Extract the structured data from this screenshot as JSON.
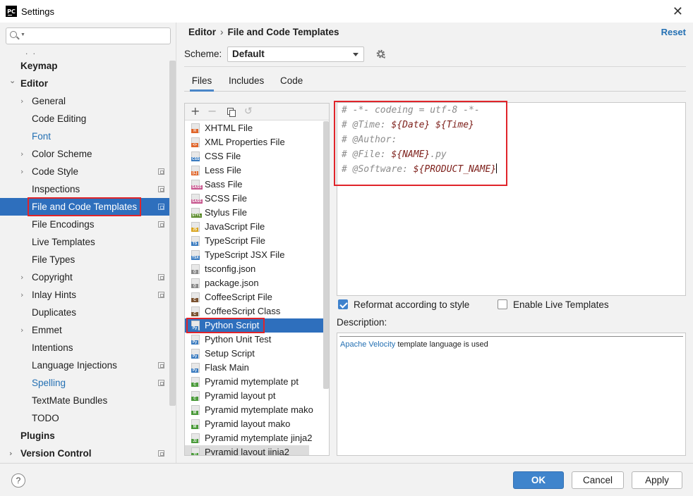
{
  "window": {
    "title": "Settings",
    "app_logo": "PC"
  },
  "sidebar": {
    "search": {
      "value": "",
      "placeholder": ""
    },
    "ellipsis": ". .",
    "items": [
      {
        "label": "Keymap",
        "level": 0,
        "bold": true
      },
      {
        "label": "Editor",
        "level": 0,
        "bold": true,
        "expanded": true
      },
      {
        "label": "General",
        "level": 1,
        "arrow": true
      },
      {
        "label": "Code Editing",
        "level": 1
      },
      {
        "label": "Font",
        "level": 1,
        "blue": true
      },
      {
        "label": "Color Scheme",
        "level": 1,
        "arrow": true
      },
      {
        "label": "Code Style",
        "level": 1,
        "arrow": true,
        "copy": true
      },
      {
        "label": "Inspections",
        "level": 1,
        "copy": true
      },
      {
        "label": "File and Code Templates",
        "level": 1,
        "copy": true,
        "selected": true
      },
      {
        "label": "File Encodings",
        "level": 1,
        "copy": true
      },
      {
        "label": "Live Templates",
        "level": 1
      },
      {
        "label": "File Types",
        "level": 1
      },
      {
        "label": "Copyright",
        "level": 1,
        "arrow": true,
        "copy": true
      },
      {
        "label": "Inlay Hints",
        "level": 1,
        "arrow": true,
        "copy": true
      },
      {
        "label": "Duplicates",
        "level": 1
      },
      {
        "label": "Emmet",
        "level": 1,
        "arrow": true
      },
      {
        "label": "Intentions",
        "level": 1
      },
      {
        "label": "Language Injections",
        "level": 1,
        "copy": true
      },
      {
        "label": "Spelling",
        "level": 1,
        "blue": true,
        "copy": true
      },
      {
        "label": "TextMate Bundles",
        "level": 1
      },
      {
        "label": "TODO",
        "level": 1
      },
      {
        "label": "Plugins",
        "level": 0,
        "bold": true
      },
      {
        "label": "Version Control",
        "level": 0,
        "bold": true,
        "arrow": true,
        "copy": true
      }
    ]
  },
  "header": {
    "breadcrumb": [
      "Editor",
      "File and Code Templates"
    ],
    "reset_label": "Reset",
    "scheme_label": "Scheme:",
    "scheme_value": "Default"
  },
  "tabs": [
    "Files",
    "Includes",
    "Code"
  ],
  "active_tab": "Files",
  "templates": [
    {
      "label": "XHTML File",
      "badge": "H",
      "color": "#e0662b"
    },
    {
      "label": "XML Properties File",
      "badge": "<>",
      "color": "#e0662b"
    },
    {
      "label": "CSS File",
      "badge": "CSS",
      "color": "#3a7bbf"
    },
    {
      "label": "Less File",
      "badge": "{L}",
      "color": "#e0662b"
    },
    {
      "label": "Sass File",
      "badge": "SASS",
      "color": "#c6538c"
    },
    {
      "label": "SCSS File",
      "badge": "SASS",
      "color": "#c6538c"
    },
    {
      "label": "Stylus File",
      "badge": "STYL",
      "color": "#5a8a2a"
    },
    {
      "label": "JavaScript File",
      "badge": "JS",
      "color": "#d9a520"
    },
    {
      "label": "TypeScript File",
      "badge": "TS",
      "color": "#3a7bbf"
    },
    {
      "label": "TypeScript JSX File",
      "badge": "TSX",
      "color": "#3a7bbf"
    },
    {
      "label": "tsconfig.json",
      "badge": "{}",
      "color": "#888888"
    },
    {
      "label": "package.json",
      "badge": "{}",
      "color": "#888888"
    },
    {
      "label": "CoffeeScript File",
      "badge": "C",
      "color": "#7a5230"
    },
    {
      "label": "CoffeeScript Class",
      "badge": "C",
      "color": "#7a5230"
    },
    {
      "label": "Python Script",
      "badge": "Py",
      "color": "#3a7bbf",
      "selected": true
    },
    {
      "label": "Python Unit Test",
      "badge": "Py",
      "color": "#3a7bbf"
    },
    {
      "label": "Setup Script",
      "badge": "Py",
      "color": "#3a7bbf"
    },
    {
      "label": "Flask Main",
      "badge": "Py",
      "color": "#3a7bbf"
    },
    {
      "label": "Pyramid mytemplate pt",
      "badge": "C",
      "color": "#4a9a3a"
    },
    {
      "label": "Pyramid layout pt",
      "badge": "C",
      "color": "#4a9a3a"
    },
    {
      "label": "Pyramid mytemplate mako",
      "badge": "M",
      "color": "#4a9a3a"
    },
    {
      "label": "Pyramid layout mako",
      "badge": "M",
      "color": "#4a9a3a"
    },
    {
      "label": "Pyramid mytemplate jinja2",
      "badge": "J2",
      "color": "#4a9a3a"
    },
    {
      "label": "Pyramid layout jinja2",
      "badge": "J2",
      "color": "#4a9a3a",
      "partial": true
    }
  ],
  "editor": {
    "lines": [
      [
        {
          "t": "# -*- codeing = utf-8 -*-"
        }
      ],
      [
        {
          "t": "# @Time: "
        },
        {
          "t": "${Date}",
          "v": true
        },
        {
          "t": " "
        },
        {
          "t": "${Time}",
          "v": true
        }
      ],
      [
        {
          "t": "# @Author:"
        }
      ],
      [
        {
          "t": "# @File: "
        },
        {
          "t": "${NAME}",
          "v": true
        },
        {
          "t": ".py"
        }
      ],
      [
        {
          "t": "# @Software: "
        },
        {
          "t": "${PRODUCT_NAME}",
          "v": true
        }
      ]
    ]
  },
  "options": {
    "reformat": {
      "label": "Reformat according to style",
      "checked": true
    },
    "live_templates": {
      "label": "Enable Live Templates",
      "checked": false
    }
  },
  "description": {
    "label": "Description:",
    "link_text": "Apache Velocity",
    "text": " template language is used"
  },
  "footer": {
    "help": "?",
    "ok": "OK",
    "cancel": "Cancel",
    "apply": "Apply"
  },
  "colors": {
    "accent": "#2e6fbd",
    "highlight_border": "#e0242a",
    "link": "#2470b3"
  }
}
